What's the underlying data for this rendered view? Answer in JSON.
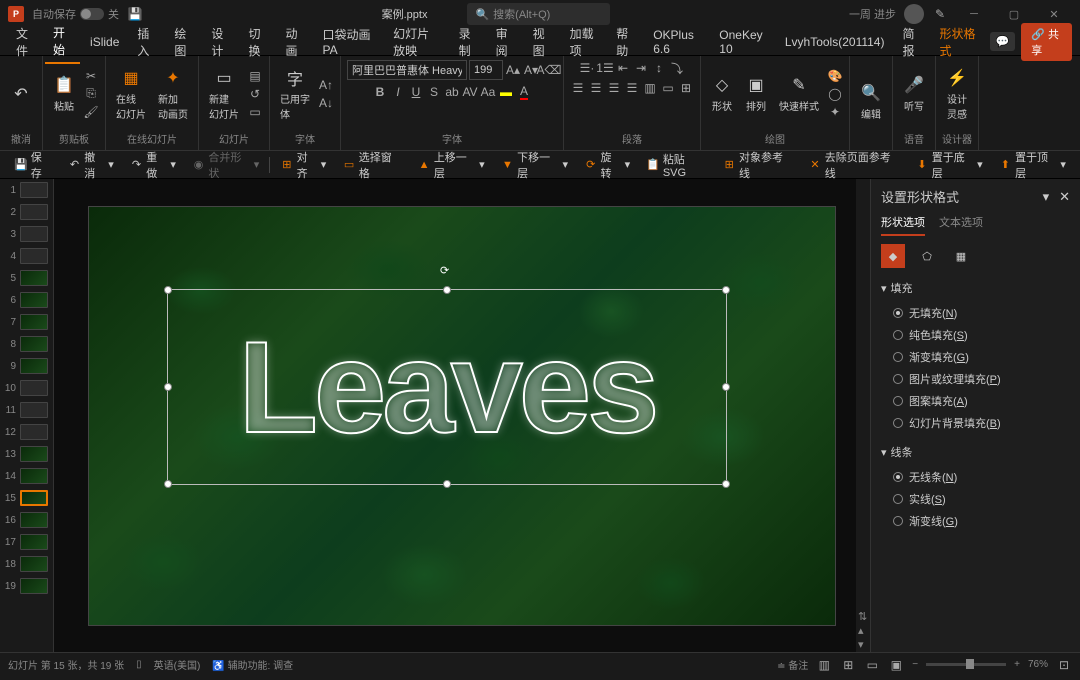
{
  "title": {
    "autosave": "自动保存",
    "off": "关",
    "filename": "案例.pptx",
    "search": "搜索(Alt+Q)",
    "user": "一周 进步"
  },
  "menu": {
    "items": [
      "文件",
      "开始",
      "iSlide",
      "插入",
      "绘图",
      "设计",
      "切换",
      "动画",
      "口袋动画 PA",
      "幻灯片放映",
      "录制",
      "审阅",
      "视图",
      "加载项",
      "帮助",
      "OKPlus 6.6",
      "OneKey 10",
      "LvyhTools(201114)",
      "简报",
      "形状格式"
    ],
    "share": "共享"
  },
  "ribbon": {
    "undo": "撤消",
    "clipboard": "剪贴板",
    "paste": "粘贴",
    "onlineSlides": "在线幻灯片",
    "onlineSlide": "在线\n幻灯片",
    "newAnim": "新加\n动画页",
    "slides": "幻灯片",
    "newSlide": "新建\n幻灯片",
    "usedFont": "已用字\n体",
    "fontGroup": "字体",
    "font2": "字体",
    "fontName": "阿里巴巴普惠体 Heavy",
    "fontSize": "199",
    "paragraph": "段落",
    "drawing": "绘图",
    "shape": "形状",
    "arrange": "排列",
    "quickStyle": "快速样式",
    "editing": "编辑",
    "voice": "语音",
    "dictate": "听写",
    "designer": "设计器",
    "designIdeas": "设计\n灵感"
  },
  "qat": {
    "save": "保存",
    "undo": "撤消",
    "redo": "重做",
    "merge": "合并形状",
    "align": "对齐",
    "selPane": "选择窗格",
    "bringFwd": "上移一层",
    "sendBack": "下移一层",
    "rotate": "旋转",
    "pasteSvg": "粘贴SVG",
    "objGuides": "对象参考线",
    "delGuides": "去除页面参考线",
    "toBack": "置于底层",
    "toFront": "置于顶层"
  },
  "slide": {
    "text": "Leaves"
  },
  "panel": {
    "title": "设置形状格式",
    "tabShape": "形状选项",
    "tabText": "文本选项",
    "fill": "填充",
    "noFill": "无填充",
    "solidFill": "纯色填充",
    "gradFill": "渐变填充",
    "picFill": "图片或纹理填充",
    "pattFill": "图案填充",
    "bgFill": "幻灯片背景填充",
    "line": "线条",
    "noLine": "无线条",
    "solidLine": "实线",
    "gradLine": "渐变线",
    "keys": {
      "noFill": "N",
      "solidFill": "S",
      "gradFill": "G",
      "picFill": "P",
      "pattFill": "A",
      "bgFill": "B",
      "noLine": "N",
      "solidLine": "S",
      "gradLine": "G"
    }
  },
  "status": {
    "slideInfo": "幻灯片 第 15 张，共 19 张",
    "lang": "英语(美国)",
    "access": "辅助功能: 调查",
    "notes": "备注",
    "zoom": "76%"
  },
  "thumbs": [
    1,
    2,
    3,
    4,
    5,
    6,
    7,
    8,
    9,
    10,
    11,
    12,
    13,
    14,
    15,
    16,
    17,
    18,
    19
  ]
}
